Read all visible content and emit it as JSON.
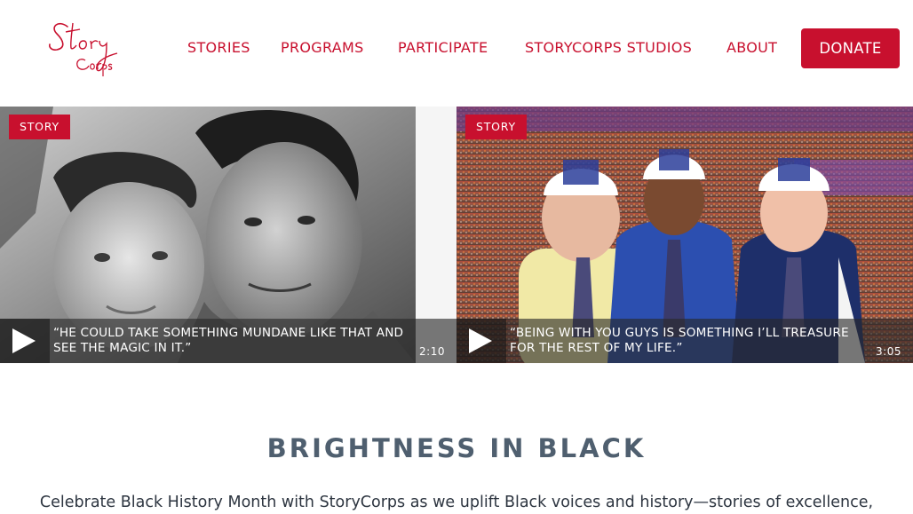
{
  "header": {
    "logo_text": "StoryCorps",
    "nav": [
      {
        "label": "STORIES"
      },
      {
        "label": "PROGRAMS"
      },
      {
        "label": "PARTICIPATE"
      },
      {
        "label": "STORYCORPS STUDIOS"
      },
      {
        "label": "ABOUT"
      }
    ],
    "donate_label": "DONATE"
  },
  "cards": [
    {
      "tag": "STORY",
      "quote": "“He could take something mundane like that and see the magic in it.”",
      "duration": "2:10"
    },
    {
      "tag": "STORY",
      "quote": "“Being with you guys is something I’ll treasure for the rest of my life.”",
      "duration": "3:05"
    }
  ],
  "section": {
    "title": "BRIGHTNESS IN BLACK",
    "intro": "Celebrate Black History Month with StoryCorps as we uplift Black voices and history—stories of excellence,"
  },
  "colors": {
    "brand_red": "#c8102e",
    "title_slate": "#4f5f6f",
    "body_text": "#2d3540"
  }
}
